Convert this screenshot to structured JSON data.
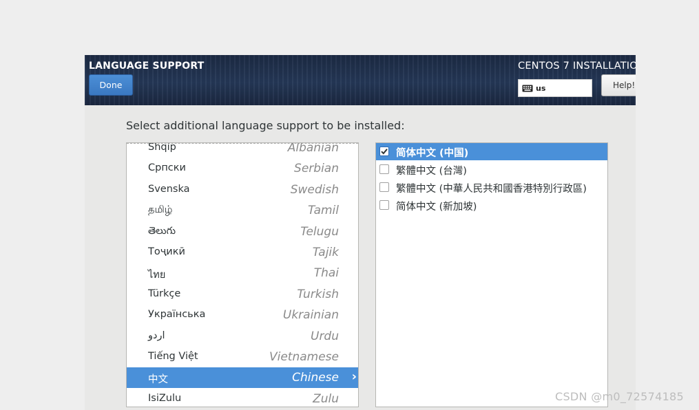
{
  "header": {
    "spoke_title": "LANGUAGE SUPPORT",
    "done_label": "Done",
    "product_title": "CENTOS 7 INSTALLATIO",
    "keyboard_icon": "keyboard-icon",
    "keyboard_layout": "us",
    "help_label": "Help!"
  },
  "instruction": "Select additional language support to be installed:",
  "languages": [
    {
      "native": "Shqip",
      "english": "Albanian"
    },
    {
      "native": "Српски",
      "english": "Serbian"
    },
    {
      "native": "Svenska",
      "english": "Swedish"
    },
    {
      "native": "தமிழ்",
      "english": "Tamil"
    },
    {
      "native": "తెలుగు",
      "english": "Telugu"
    },
    {
      "native": "Тоҷикӣ",
      "english": "Tajik"
    },
    {
      "native": "ไทย",
      "english": "Thai"
    },
    {
      "native": "Türkçe",
      "english": "Turkish"
    },
    {
      "native": "Українська",
      "english": "Ukrainian"
    },
    {
      "native": "اردو",
      "english": "Urdu"
    },
    {
      "native": "Tiếng Việt",
      "english": "Vietnamese"
    },
    {
      "native": "中文",
      "english": "Chinese",
      "selected": true,
      "arrow": "›"
    },
    {
      "native": "IsiZulu",
      "english": "Zulu"
    }
  ],
  "locales": [
    {
      "label": "简体中文 (中国)",
      "checked": true
    },
    {
      "label": "繁體中文 (台灣)",
      "checked": false
    },
    {
      "label": "繁體中文 (中華人民共和國香港特別行政區)",
      "checked": false
    },
    {
      "label": "简体中文 (新加坡)",
      "checked": false
    }
  ],
  "watermark": "CSDN @m0_72574185",
  "colors": {
    "accent": "#4a90d9",
    "header_dark": "#1c2a44",
    "done_button": "#3a78c2"
  }
}
